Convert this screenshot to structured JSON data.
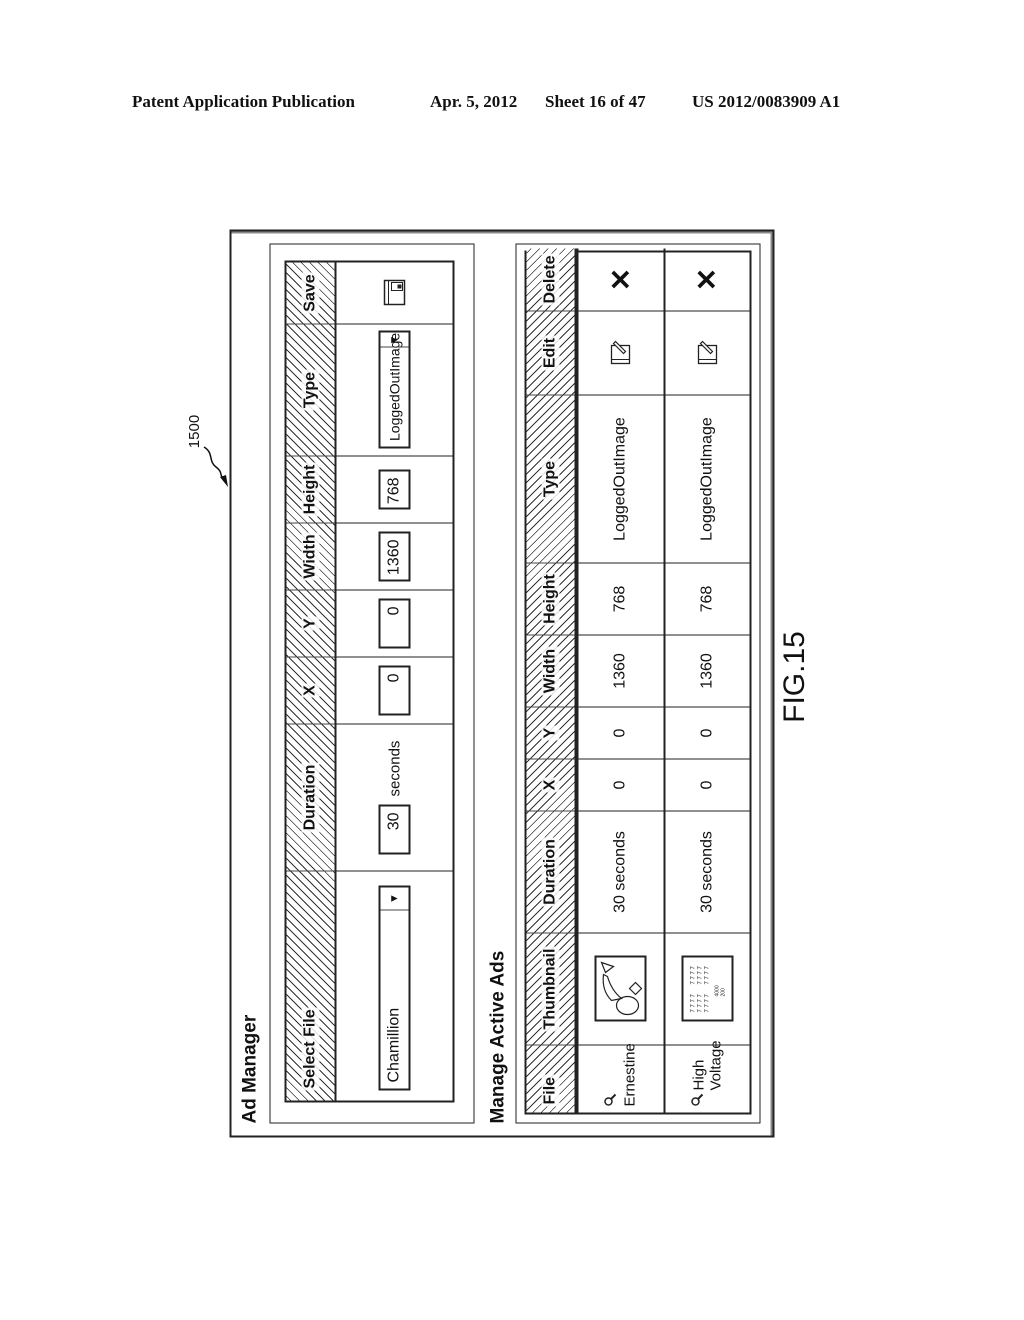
{
  "header": {
    "publication": "Patent Application Publication",
    "date": "Apr. 5, 2012",
    "sheet": "Sheet 16 of 47",
    "number": "US 2012/0083909 A1"
  },
  "reference_numeral": "1500",
  "figure_label": "FIG.15",
  "app": {
    "title": "Ad Manager",
    "form": {
      "headers": {
        "select_file": "Select File",
        "duration": "Duration",
        "x": "X",
        "y": "Y",
        "width": "Width",
        "height": "Height",
        "type": "Type",
        "save": "Save"
      },
      "values": {
        "file": "Chamillion",
        "duration": "30",
        "duration_unit": "seconds",
        "x": "0",
        "y": "0",
        "width": "1360",
        "height": "768",
        "type": "LoggedOutImage"
      },
      "icons": {
        "dropdown": "dropdown-arrow-icon",
        "save": "save-icon"
      }
    },
    "active_ads": {
      "title": "Manage Active Ads",
      "columns": [
        "File",
        "Thumbnail",
        "Duration",
        "X",
        "Y",
        "Width",
        "Height",
        "Type",
        "Edit",
        "Delete"
      ],
      "rows": [
        {
          "file": "Ernestine",
          "thumbnail": "shapes-thumbnail",
          "duration": "30 seconds",
          "x": "0",
          "y": "0",
          "width": "1360",
          "height": "768",
          "type": "LoggedOutImage"
        },
        {
          "file": "High Voltage",
          "thumbnail": "chart-thumbnail",
          "duration": "30 seconds",
          "x": "0",
          "y": "0",
          "width": "1360",
          "height": "768",
          "type": "LoggedOutImage"
        }
      ],
      "icons": {
        "file": "magnifier-icon",
        "edit": "edit-icon",
        "delete": "delete-x-icon"
      },
      "delete_glyph": "✕"
    }
  }
}
